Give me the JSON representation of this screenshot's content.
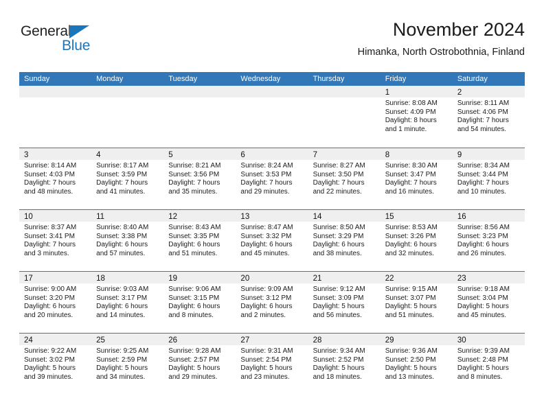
{
  "brand": {
    "name_part1": "General",
    "name_part2": "Blue",
    "flag_icon": "blue-triangle-flag"
  },
  "header": {
    "title": "November 2024",
    "subtitle": "Himanka, North Ostrobothnia, Finland"
  },
  "colors": {
    "header_blue": "#3277b8",
    "brand_blue": "#1b75bb",
    "daynum_band": "#efefef",
    "text": "#1a1a1a"
  },
  "weekdays": [
    "Sunday",
    "Monday",
    "Tuesday",
    "Wednesday",
    "Thursday",
    "Friday",
    "Saturday"
  ],
  "weeks": [
    [
      {
        "day": "",
        "empty": true
      },
      {
        "day": "",
        "empty": true
      },
      {
        "day": "",
        "empty": true
      },
      {
        "day": "",
        "empty": true
      },
      {
        "day": "",
        "empty": true
      },
      {
        "day": "1",
        "sunrise": "Sunrise: 8:08 AM",
        "sunset": "Sunset: 4:09 PM",
        "daylight1": "Daylight: 8 hours",
        "daylight2": "and 1 minute."
      },
      {
        "day": "2",
        "sunrise": "Sunrise: 8:11 AM",
        "sunset": "Sunset: 4:06 PM",
        "daylight1": "Daylight: 7 hours",
        "daylight2": "and 54 minutes."
      }
    ],
    [
      {
        "day": "3",
        "sunrise": "Sunrise: 8:14 AM",
        "sunset": "Sunset: 4:03 PM",
        "daylight1": "Daylight: 7 hours",
        "daylight2": "and 48 minutes."
      },
      {
        "day": "4",
        "sunrise": "Sunrise: 8:17 AM",
        "sunset": "Sunset: 3:59 PM",
        "daylight1": "Daylight: 7 hours",
        "daylight2": "and 41 minutes."
      },
      {
        "day": "5",
        "sunrise": "Sunrise: 8:21 AM",
        "sunset": "Sunset: 3:56 PM",
        "daylight1": "Daylight: 7 hours",
        "daylight2": "and 35 minutes."
      },
      {
        "day": "6",
        "sunrise": "Sunrise: 8:24 AM",
        "sunset": "Sunset: 3:53 PM",
        "daylight1": "Daylight: 7 hours",
        "daylight2": "and 29 minutes."
      },
      {
        "day": "7",
        "sunrise": "Sunrise: 8:27 AM",
        "sunset": "Sunset: 3:50 PM",
        "daylight1": "Daylight: 7 hours",
        "daylight2": "and 22 minutes."
      },
      {
        "day": "8",
        "sunrise": "Sunrise: 8:30 AM",
        "sunset": "Sunset: 3:47 PM",
        "daylight1": "Daylight: 7 hours",
        "daylight2": "and 16 minutes."
      },
      {
        "day": "9",
        "sunrise": "Sunrise: 8:34 AM",
        "sunset": "Sunset: 3:44 PM",
        "daylight1": "Daylight: 7 hours",
        "daylight2": "and 10 minutes."
      }
    ],
    [
      {
        "day": "10",
        "sunrise": "Sunrise: 8:37 AM",
        "sunset": "Sunset: 3:41 PM",
        "daylight1": "Daylight: 7 hours",
        "daylight2": "and 3 minutes."
      },
      {
        "day": "11",
        "sunrise": "Sunrise: 8:40 AM",
        "sunset": "Sunset: 3:38 PM",
        "daylight1": "Daylight: 6 hours",
        "daylight2": "and 57 minutes."
      },
      {
        "day": "12",
        "sunrise": "Sunrise: 8:43 AM",
        "sunset": "Sunset: 3:35 PM",
        "daylight1": "Daylight: 6 hours",
        "daylight2": "and 51 minutes."
      },
      {
        "day": "13",
        "sunrise": "Sunrise: 8:47 AM",
        "sunset": "Sunset: 3:32 PM",
        "daylight1": "Daylight: 6 hours",
        "daylight2": "and 45 minutes."
      },
      {
        "day": "14",
        "sunrise": "Sunrise: 8:50 AM",
        "sunset": "Sunset: 3:29 PM",
        "daylight1": "Daylight: 6 hours",
        "daylight2": "and 38 minutes."
      },
      {
        "day": "15",
        "sunrise": "Sunrise: 8:53 AM",
        "sunset": "Sunset: 3:26 PM",
        "daylight1": "Daylight: 6 hours",
        "daylight2": "and 32 minutes."
      },
      {
        "day": "16",
        "sunrise": "Sunrise: 8:56 AM",
        "sunset": "Sunset: 3:23 PM",
        "daylight1": "Daylight: 6 hours",
        "daylight2": "and 26 minutes."
      }
    ],
    [
      {
        "day": "17",
        "sunrise": "Sunrise: 9:00 AM",
        "sunset": "Sunset: 3:20 PM",
        "daylight1": "Daylight: 6 hours",
        "daylight2": "and 20 minutes."
      },
      {
        "day": "18",
        "sunrise": "Sunrise: 9:03 AM",
        "sunset": "Sunset: 3:17 PM",
        "daylight1": "Daylight: 6 hours",
        "daylight2": "and 14 minutes."
      },
      {
        "day": "19",
        "sunrise": "Sunrise: 9:06 AM",
        "sunset": "Sunset: 3:15 PM",
        "daylight1": "Daylight: 6 hours",
        "daylight2": "and 8 minutes."
      },
      {
        "day": "20",
        "sunrise": "Sunrise: 9:09 AM",
        "sunset": "Sunset: 3:12 PM",
        "daylight1": "Daylight: 6 hours",
        "daylight2": "and 2 minutes."
      },
      {
        "day": "21",
        "sunrise": "Sunrise: 9:12 AM",
        "sunset": "Sunset: 3:09 PM",
        "daylight1": "Daylight: 5 hours",
        "daylight2": "and 56 minutes."
      },
      {
        "day": "22",
        "sunrise": "Sunrise: 9:15 AM",
        "sunset": "Sunset: 3:07 PM",
        "daylight1": "Daylight: 5 hours",
        "daylight2": "and 51 minutes."
      },
      {
        "day": "23",
        "sunrise": "Sunrise: 9:18 AM",
        "sunset": "Sunset: 3:04 PM",
        "daylight1": "Daylight: 5 hours",
        "daylight2": "and 45 minutes."
      }
    ],
    [
      {
        "day": "24",
        "sunrise": "Sunrise: 9:22 AM",
        "sunset": "Sunset: 3:02 PM",
        "daylight1": "Daylight: 5 hours",
        "daylight2": "and 39 minutes."
      },
      {
        "day": "25",
        "sunrise": "Sunrise: 9:25 AM",
        "sunset": "Sunset: 2:59 PM",
        "daylight1": "Daylight: 5 hours",
        "daylight2": "and 34 minutes."
      },
      {
        "day": "26",
        "sunrise": "Sunrise: 9:28 AM",
        "sunset": "Sunset: 2:57 PM",
        "daylight1": "Daylight: 5 hours",
        "daylight2": "and 29 minutes."
      },
      {
        "day": "27",
        "sunrise": "Sunrise: 9:31 AM",
        "sunset": "Sunset: 2:54 PM",
        "daylight1": "Daylight: 5 hours",
        "daylight2": "and 23 minutes."
      },
      {
        "day": "28",
        "sunrise": "Sunrise: 9:34 AM",
        "sunset": "Sunset: 2:52 PM",
        "daylight1": "Daylight: 5 hours",
        "daylight2": "and 18 minutes."
      },
      {
        "day": "29",
        "sunrise": "Sunrise: 9:36 AM",
        "sunset": "Sunset: 2:50 PM",
        "daylight1": "Daylight: 5 hours",
        "daylight2": "and 13 minutes."
      },
      {
        "day": "30",
        "sunrise": "Sunrise: 9:39 AM",
        "sunset": "Sunset: 2:48 PM",
        "daylight1": "Daylight: 5 hours",
        "daylight2": "and 8 minutes."
      }
    ]
  ]
}
